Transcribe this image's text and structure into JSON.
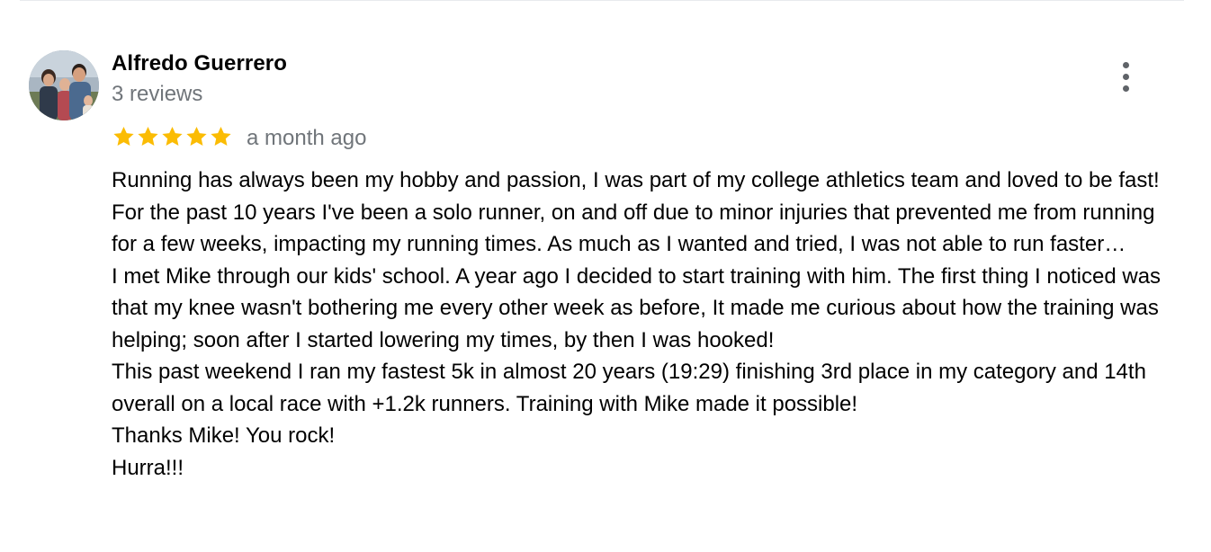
{
  "review": {
    "reviewer_name": "Alfredo Guerrero",
    "review_count": "3 reviews",
    "rating": 5,
    "rating_max": 5,
    "star_color": "#fbbc04",
    "time": "a month ago",
    "paragraphs": [
      "Running has always been my hobby and passion, I was part of my college athletics team and loved to be fast!",
      "For the past 10 years I've been a solo runner, on and off due to minor injuries that prevented me from running for a few weeks, impacting my running times. As much as I wanted and tried, I was not able to run faster…",
      "I met Mike through our kids' school. A year ago I decided to start training with him. The first thing I noticed was that my knee wasn't bothering me every other week as before, It made me curious about how the training was helping; soon after I started lowering my times, by then I was hooked!",
      "This past weekend I ran my fastest 5k in almost 20 years (19:29) finishing 3rd place in my category and 14th overall on a local race with +1.2k runners. Training with Mike made it possible!",
      "Thanks Mike! You rock!",
      "Hurra!!!"
    ],
    "menu_icon": "more-vert-icon",
    "avatar": "profile-photo"
  }
}
